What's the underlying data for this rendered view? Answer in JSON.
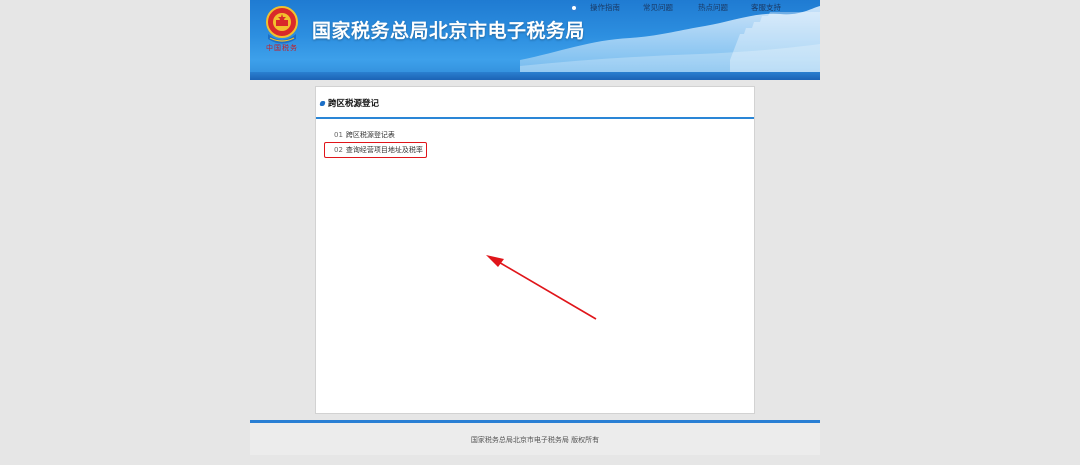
{
  "header": {
    "site_title": "国家税务总局北京市电子税务局",
    "emblem_caption": "中国税务",
    "nav": [
      {
        "label": "操作指南"
      },
      {
        "label": "常见问题"
      },
      {
        "label": "热点问题"
      },
      {
        "label": "客服支持"
      }
    ]
  },
  "card": {
    "title": "跨区税源登记",
    "items": [
      {
        "num": "01",
        "label": "跨区税源登记表"
      },
      {
        "num": "02",
        "label": "查询经营项目地址及税率"
      }
    ]
  },
  "footer": {
    "text": "国家税务总局北京市电子税务局 版权所有"
  },
  "colors": {
    "header_blue": "#2d8fe0",
    "accent_line": "#2a86d6",
    "highlight_red": "#e0151a",
    "page_bg": "#e6e6e6"
  },
  "icons": [
    "national-emblem-icon",
    "nav-dot-icon",
    "title-bullet-icon",
    "annotation-arrow-icon"
  ]
}
